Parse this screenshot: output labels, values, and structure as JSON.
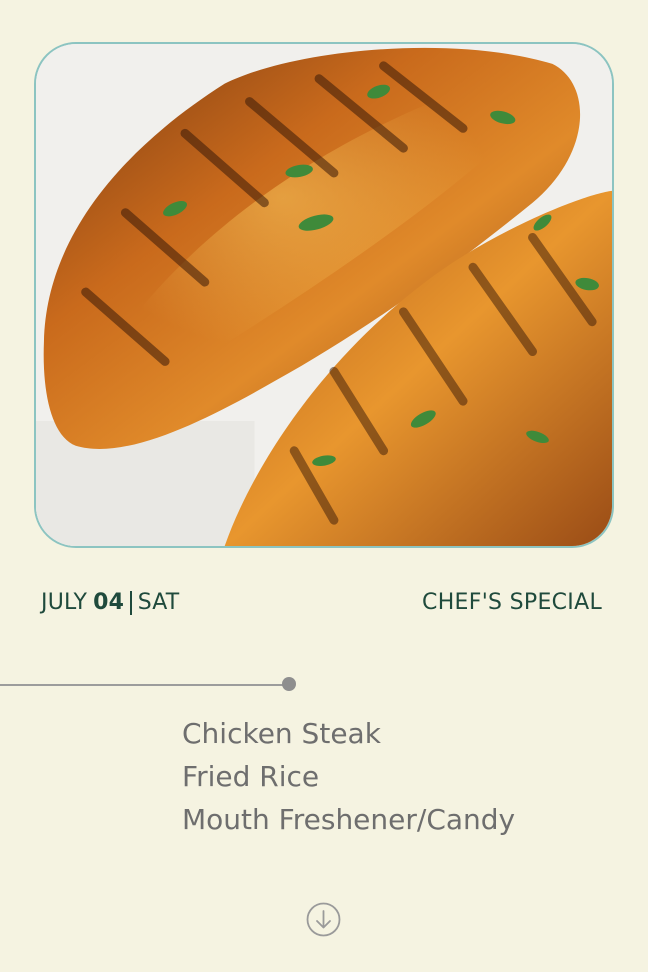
{
  "date": {
    "month": "JULY",
    "day": "04",
    "weekday": "SAT"
  },
  "tagline": "CHEF'S SPECIAL",
  "menu_items": [
    "Chicken Steak",
    "Fried Rice",
    "Mouth Freshener/Candy"
  ],
  "scroll_icon": "arrow-down-circle-icon",
  "colors": {
    "background": "#f5f3e1",
    "accent": "#1f4a3c",
    "frame_border": "#8cc4c1",
    "menu_text": "#6e6e6e"
  }
}
